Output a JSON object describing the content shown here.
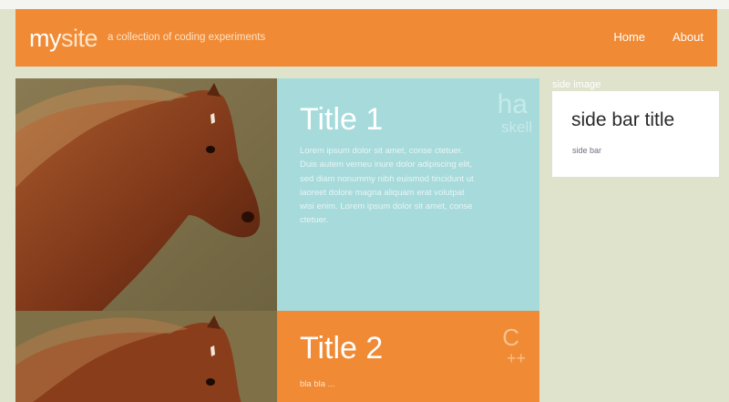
{
  "header": {
    "logo_part1": "my",
    "logo_part2": "site",
    "tagline": "a collection of coding experiments",
    "nav": [
      "Home",
      "About"
    ]
  },
  "posts": [
    {
      "title": "Title 1",
      "body": "Lorem ipsum dolor sit amet, conse ctetuer. Duis autem vemeu inure dolor adipiscing elit, sed diam nonummy nibh euismod tincidunt ut laoreet dolore magna aliquam erat volutpat wisi enim. Lorem ipsum dolor sit amet, conse ctetuer.",
      "tag_line1": "ha",
      "tag_line2": "skell"
    },
    {
      "title": "Title 2",
      "body": "bla bla ...",
      "tag_line1": "C",
      "tag_line2": "++"
    }
  ],
  "sidebar": {
    "image_label": "side image",
    "title": "side bar title",
    "text": "side bar"
  },
  "colors": {
    "accent": "#f08a34",
    "teal": "#a6dadb",
    "background": "#dfe3cc"
  }
}
